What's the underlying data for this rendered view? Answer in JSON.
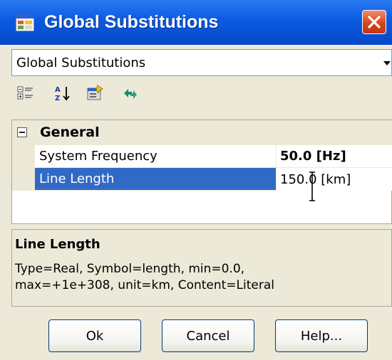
{
  "window": {
    "title": "Global Substitutions",
    "icon": "dialog-grid-icon",
    "close_icon": "close-icon"
  },
  "object_selector": {
    "selected": "Global Substitutions"
  },
  "toolbar": {
    "icons": [
      "categorized-icon",
      "alphabetical-sort-icon",
      "property-pages-icon",
      "refresh-arrows-icon"
    ]
  },
  "grid": {
    "category": "General",
    "properties": [
      {
        "name": "System Frequency",
        "value": "50.0 [Hz]",
        "value_bold": true
      },
      {
        "name": "Line Length",
        "value": "150.0 [km]",
        "selected": true,
        "editing": true
      }
    ]
  },
  "help": {
    "title": "Line Length",
    "line1": "Type=Real, Symbol=length, min=0.0,",
    "line2": "max=+1e+308, unit=km, Content=Literal"
  },
  "buttons": {
    "ok": "Ok",
    "cancel": "Cancel",
    "help": "Help..."
  },
  "colors": {
    "titlebar": "#0b5ae0",
    "selection": "#316ac5",
    "close": "#d9441c",
    "face": "#ece9d8"
  }
}
